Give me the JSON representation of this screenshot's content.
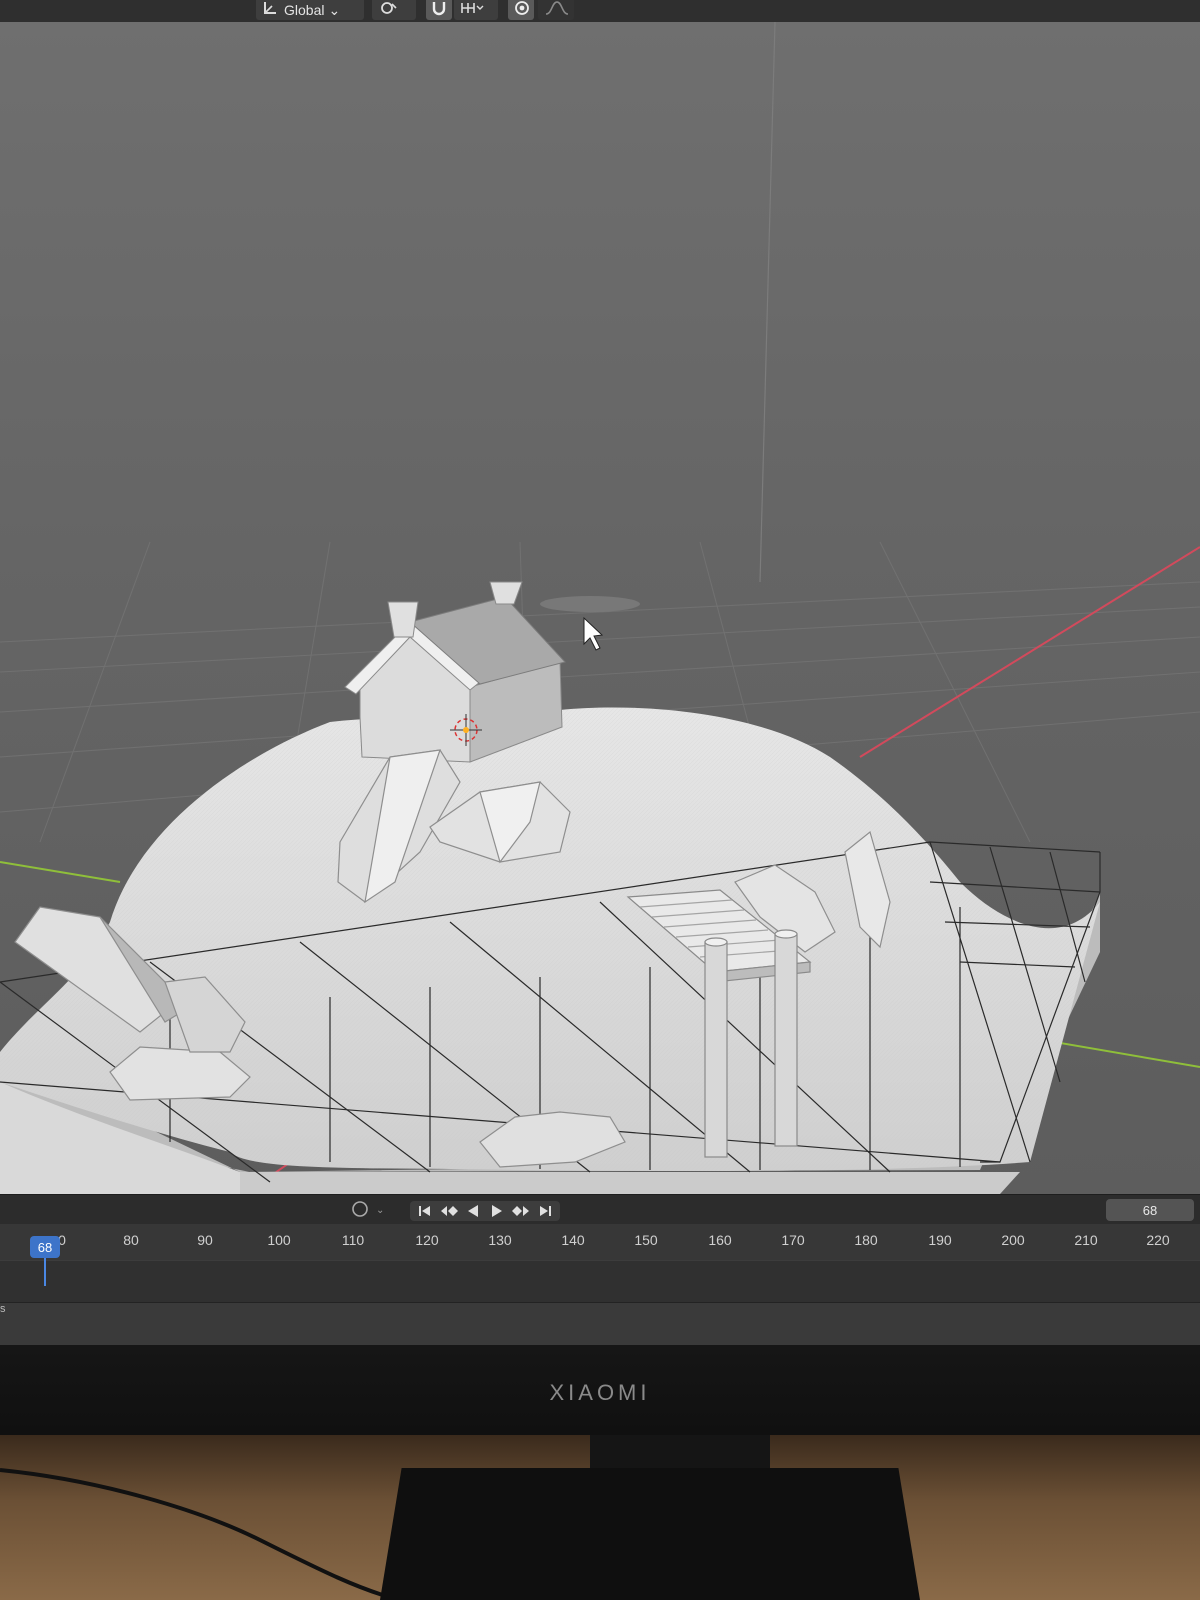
{
  "header": {
    "transform_orientation": "Global",
    "chevron": "⌄"
  },
  "viewport": {
    "mode_menu": "…",
    "objects": [
      "house",
      "terrain",
      "rocks",
      "wooden-dock",
      "grid-boundary"
    ]
  },
  "timeline": {
    "current_frame": "68",
    "playhead_label": "68",
    "ticks": [
      "0",
      "80",
      "90",
      "100",
      "110",
      "120",
      "130",
      "140",
      "150",
      "160",
      "170",
      "180",
      "190",
      "200",
      "210",
      "220"
    ],
    "playback_icons": [
      "jump-start-icon",
      "prev-keyframe-icon",
      "play-reverse-icon",
      "play-icon",
      "next-keyframe-icon",
      "jump-end-icon"
    ]
  },
  "status": {
    "left_text": "s"
  },
  "monitor": {
    "brand": "XIAOMI"
  }
}
